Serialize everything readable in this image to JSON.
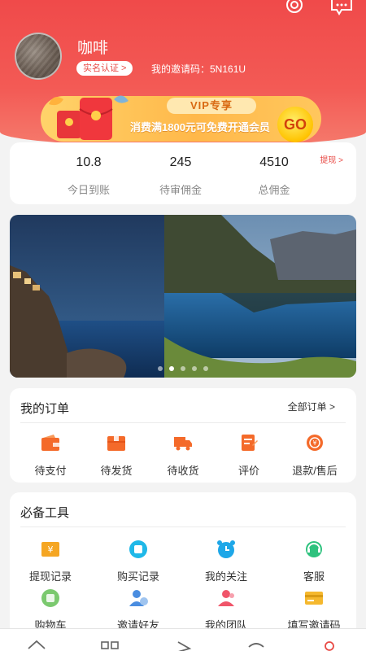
{
  "header": {
    "username": "咖啡",
    "verify_label": "实名认证 >",
    "invite_code": "我的邀请码：5N161U",
    "icons": [
      "settings-icon",
      "message-icon"
    ]
  },
  "vip": {
    "title": "VIP专享",
    "subtitle": "消费满1800元可免费开通会员",
    "go_label": "GO"
  },
  "stats": {
    "withdraw_link": "提现 >",
    "items": [
      {
        "value": "10.8",
        "label": "今日到账"
      },
      {
        "value": "245",
        "label": "待审佣金"
      },
      {
        "value": "4510",
        "label": "总佣金"
      }
    ]
  },
  "banner": {
    "slides": 5,
    "active": 1
  },
  "orders": {
    "title": "我的订单",
    "all_link": "全部订单 >",
    "items": [
      {
        "label": "待支付",
        "icon": "wallet-icon"
      },
      {
        "label": "待发货",
        "icon": "package-icon"
      },
      {
        "label": "待收货",
        "icon": "truck-icon"
      },
      {
        "label": "评价",
        "icon": "review-icon"
      },
      {
        "label": "退款/售后",
        "icon": "refund-icon"
      }
    ]
  },
  "tools": {
    "title": "必备工具",
    "items": [
      {
        "label": "提现记录",
        "icon": "withdraw-record-icon"
      },
      {
        "label": "购买记录",
        "icon": "purchase-record-icon"
      },
      {
        "label": "我的关注",
        "icon": "alarm-clock-icon"
      },
      {
        "label": "客服",
        "icon": "customer-service-icon"
      },
      {
        "label": "购物车",
        "icon": "cart-icon"
      },
      {
        "label": "邀请好友",
        "icon": "invite-friend-icon"
      },
      {
        "label": "我的团队",
        "icon": "team-icon"
      },
      {
        "label": "填写邀请码",
        "icon": "invite-code-card-icon"
      }
    ]
  },
  "colors": {
    "brand_red": "#f04a4a",
    "accent_orange": "#f46a2a",
    "gold": "#ffc300"
  }
}
